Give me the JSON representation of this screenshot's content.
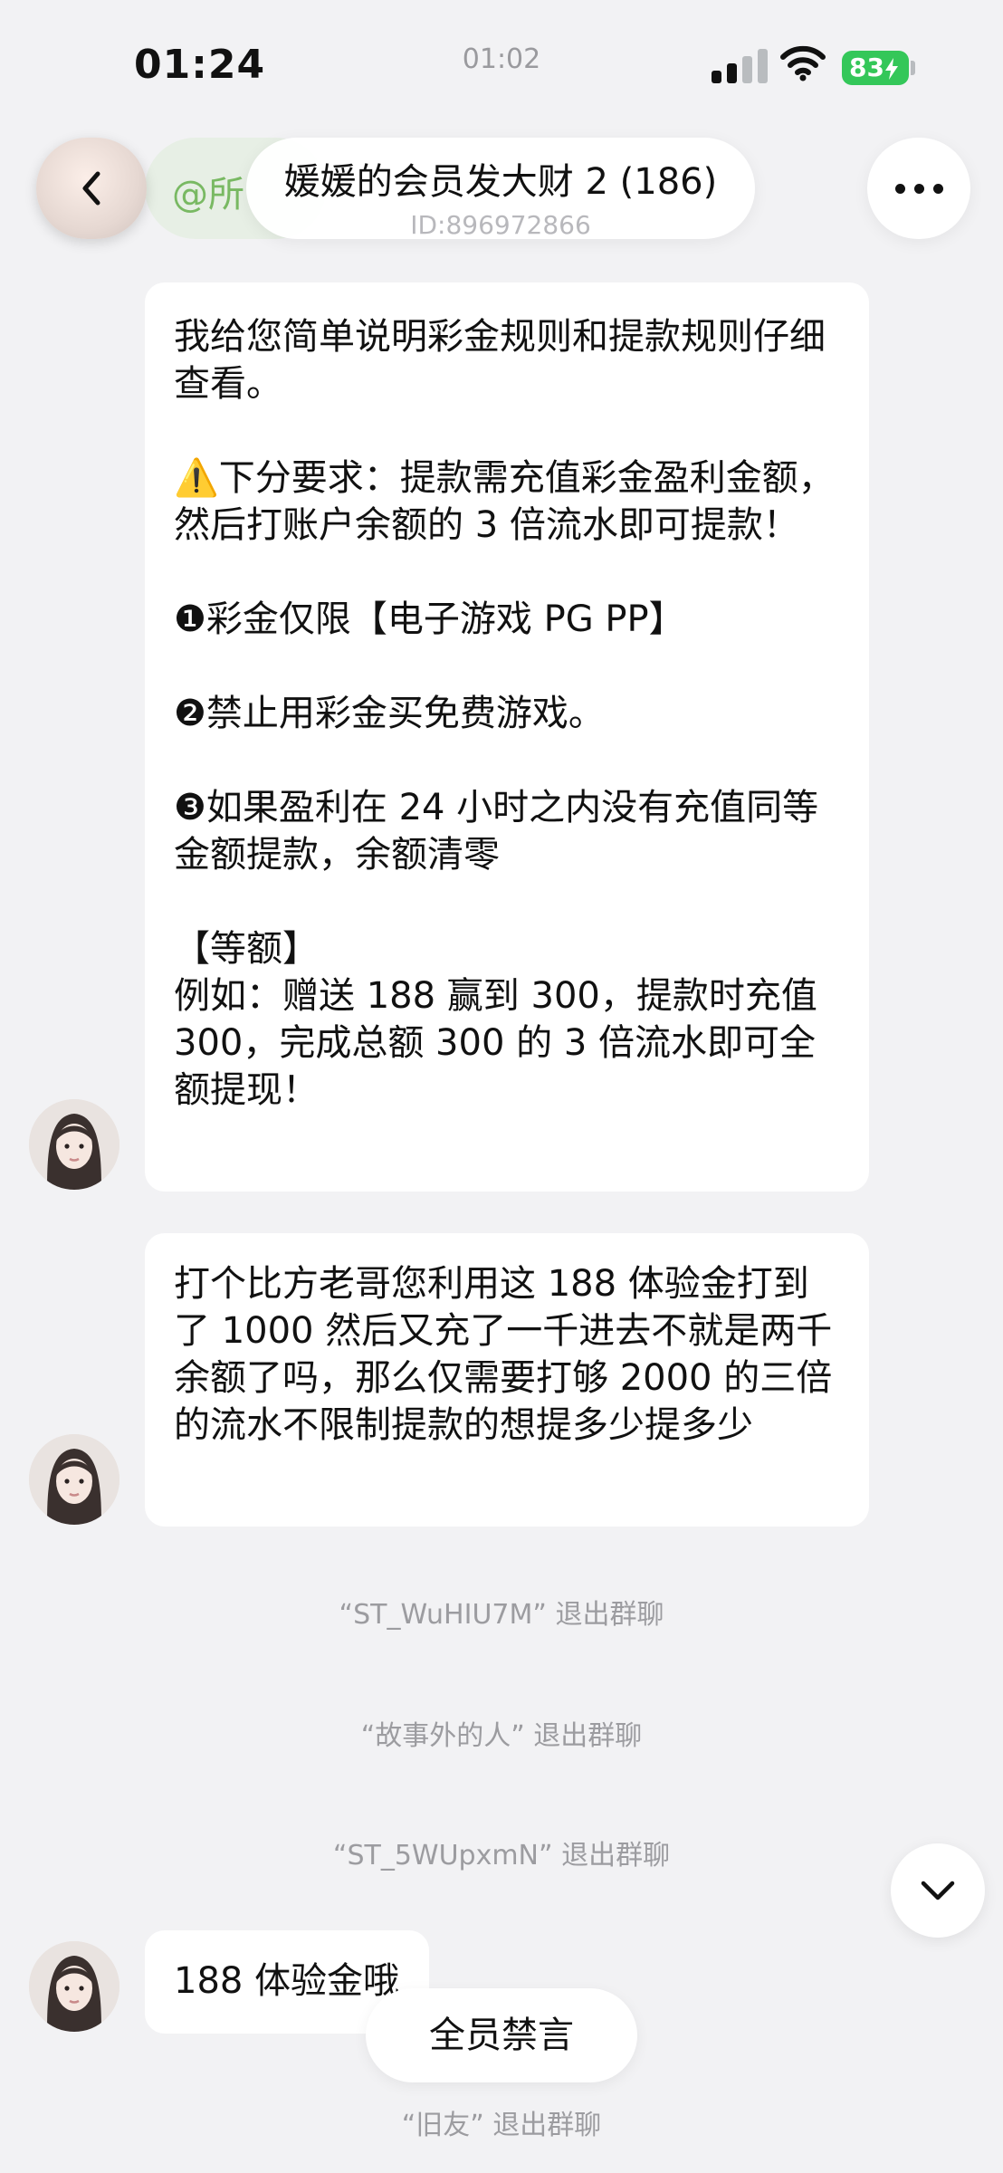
{
  "status_bar": {
    "time": "01:24",
    "center_time": "01:02",
    "battery": "83"
  },
  "header": {
    "pinned_mention": "@所",
    "title": "媛媛的会员发大财 2 (186)",
    "group_id": "ID:896972866"
  },
  "messages": [
    {
      "text": "我给您简单说明彩金规则和提款规则仔细查看。\n\n⚠️下分要求：提款需充值彩金盈利金额，然后打账户余额的 3 倍流水即可提款！\n\n❶彩金仅限【电子游戏 PG PP】\n\n❷禁止用彩金买免费游戏。\n\n❸如果盈利在 24 小时之内没有充值同等金额提款，余额清零\n\n【等额】\n例如：赠送 188 赢到 300，提款时充值 300，完成总额 300 的 3 倍流水即可全额提现！"
    },
    {
      "text": "打个比方老哥您利用这 188 体验金打到了 1000 然后又充了一千进去不就是两千余额了吗，那么仅需要打够 2000 的三倍的流水不限制提款的想提多少提多少"
    },
    {
      "text": "188 体验金哦"
    }
  ],
  "system_messages": [
    "“ST_WuHIU7M” 退出群聊",
    "“故事外的人” 退出群聊",
    "“ST_5WUpxmN” 退出群聊",
    "“旧友” 退出群聊"
  ],
  "mute_notice": "全员禁言",
  "colors": {
    "background": "#f2f2f4",
    "bubble": "#ffffff",
    "battery": "#34c759",
    "mention": "#79b963"
  }
}
